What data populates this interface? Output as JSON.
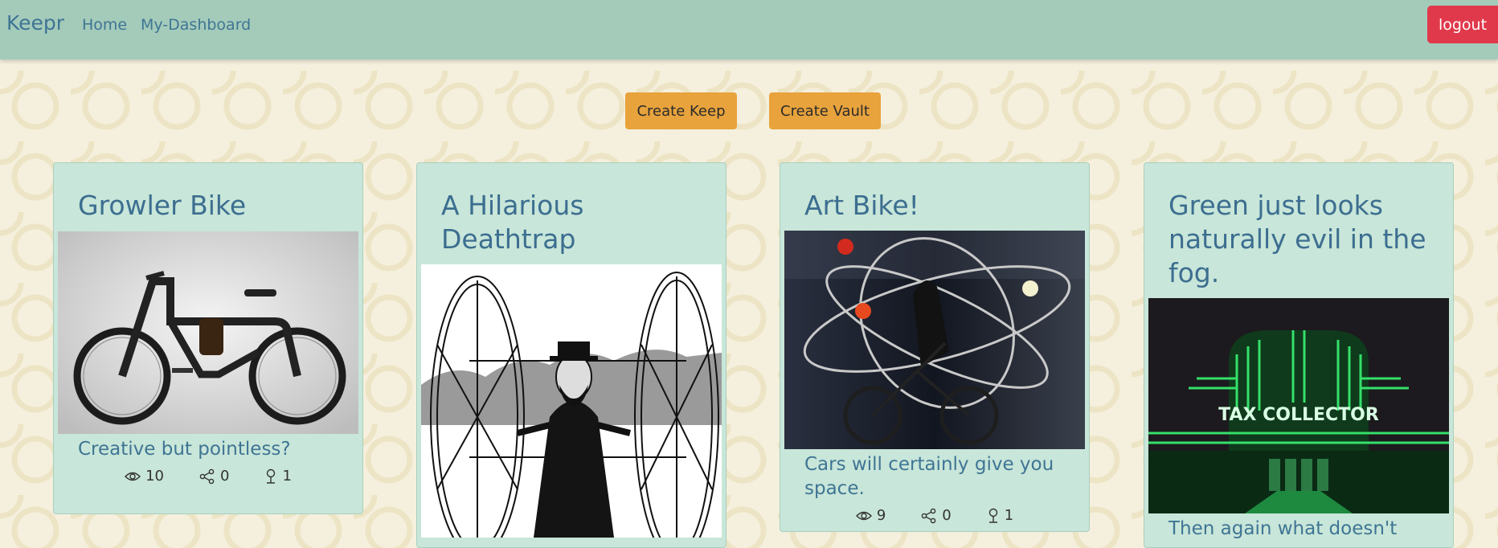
{
  "nav": {
    "brand": "Keepr",
    "home": "Home",
    "dashboard": "My-Dashboard",
    "logout": "logout"
  },
  "actions": {
    "create_keep": "Create Keep",
    "create_vault": "Create Vault"
  },
  "keeps": [
    {
      "title": "Growler Bike",
      "description": "Creative but pointless?",
      "views": "10",
      "shares": "0",
      "keeps": "1"
    },
    {
      "title": "A Hilarious Deathtrap",
      "description": "",
      "views": "",
      "shares": "",
      "keeps": ""
    },
    {
      "title": "Art Bike!",
      "description": "Cars will certainly give you space.",
      "views": "9",
      "shares": "0",
      "keeps": "1"
    },
    {
      "title": "Green just looks naturally evil in the fog.",
      "description": "Then again what doesn't",
      "views": "",
      "shares": "",
      "keeps": ""
    }
  ],
  "image_text": {
    "sign": "TAX COLLECTOR"
  },
  "colors": {
    "navbar": "#a4cbba",
    "brand_text": "#3f7594",
    "logout": "#e0394b",
    "action": "#e8a33c",
    "card": "#c8e6d9"
  }
}
